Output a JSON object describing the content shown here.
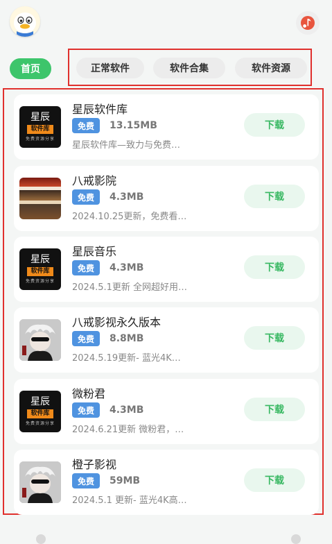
{
  "tabs": {
    "home": "首页",
    "items": [
      "正常软件",
      "软件合集",
      "软件资源"
    ]
  },
  "brand_icon": {
    "title": "星辰",
    "subtitle": "软件库",
    "footer": "免费资源分享"
  },
  "apps": [
    {
      "name": "星辰软件库",
      "badge": "免费",
      "size": "13.15MB",
      "desc": "星辰软件库—致力与免费…",
      "icon": "brand",
      "action": "下载"
    },
    {
      "name": "八戒影院",
      "badge": "免费",
      "size": "4.3MB",
      "desc": "2024.10.25更新，免费看…",
      "icon": "poster",
      "action": "下载"
    },
    {
      "name": "星辰音乐",
      "badge": "免费",
      "size": "4.3MB",
      "desc": "2024.5.1更新 全网超好用…",
      "icon": "brand",
      "action": "下载"
    },
    {
      "name": "八戒影视永久版本",
      "badge": "免费",
      "size": "8.8MB",
      "desc": "2024.5.19更新- 蓝光4K…",
      "icon": "anime",
      "action": "下载"
    },
    {
      "name": "微粉君",
      "badge": "免费",
      "size": "4.3MB",
      "desc": "2024.6.21更新 微粉君，…",
      "icon": "brand",
      "action": "下载"
    },
    {
      "name": "橙子影视",
      "badge": "免费",
      "size": "59MB",
      "desc": "2024.5.1 更新- 蓝光4K高…",
      "icon": "anime",
      "action": "下载"
    }
  ],
  "colors": {
    "accent_green": "#3dc56b",
    "badge_blue": "#4f93e0",
    "highlight_red": "#e0302d",
    "download_bg": "#e9f7ee"
  },
  "icons": {
    "avatar": "duck-avatar-icon",
    "music": "music-note-icon"
  }
}
